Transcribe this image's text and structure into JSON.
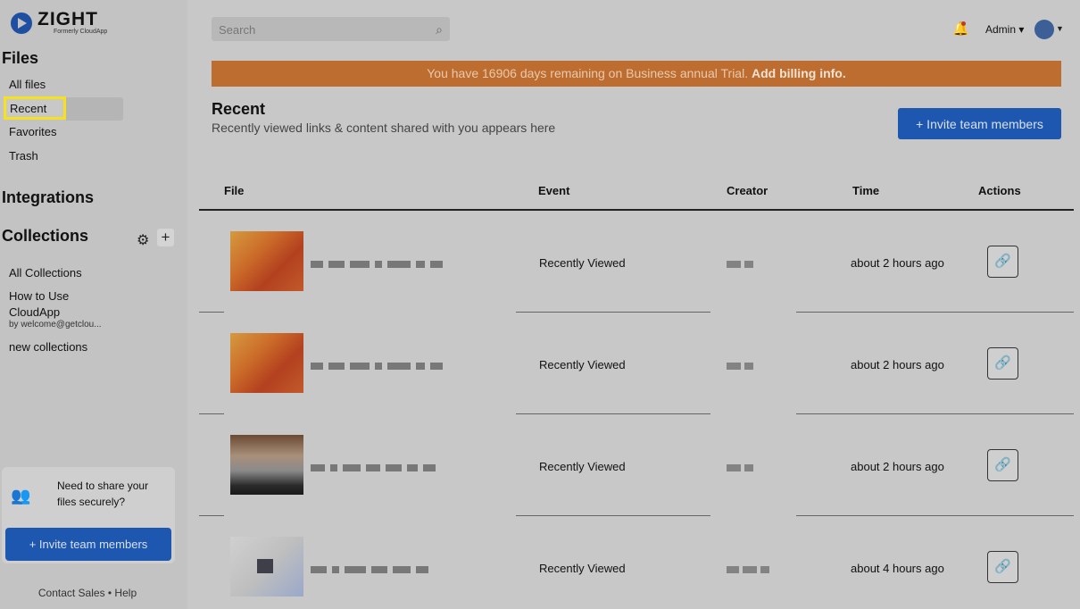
{
  "brand": {
    "name": "ZIGHT",
    "sub": "Formerly CloudApp"
  },
  "sidebar": {
    "files_title": "Files",
    "nav": [
      "All files",
      "Recent",
      "Favorites",
      "Trash"
    ],
    "integrations_title": "Integrations",
    "collections_title": "Collections",
    "collections": {
      "all": "All Collections",
      "how_to_line1": "How to Use",
      "how_to_line2": "CloudApp",
      "how_to_by": "by welcome@getclou...",
      "new": "new collections"
    },
    "promo": {
      "text": "Need to share your files securely?",
      "button": "+ Invite team members"
    },
    "footer": "Contact Sales • Help"
  },
  "topbar": {
    "search_placeholder": "Search",
    "admin_label": "Admin ▾"
  },
  "banner": {
    "text": "You have 16906 days remaining on Business annual Trial.",
    "link": "Add billing info."
  },
  "main": {
    "title": "Recent",
    "subtitle": "Recently viewed links & content shared with you appears here",
    "invite_button": "+ Invite team members",
    "columns": [
      "File",
      "Event",
      "Creator",
      "Time",
      "Actions"
    ],
    "rows": [
      {
        "event": "Recently Viewed",
        "time": "about 2 hours ago"
      },
      {
        "event": "Recently Viewed",
        "time": "about 2 hours ago"
      },
      {
        "event": "Recently Viewed",
        "time": "about 2 hours ago"
      },
      {
        "event": "Recently Viewed",
        "time": "about 4 hours ago"
      }
    ]
  },
  "colors": {
    "accent": "#1e57b0",
    "banner": "#bd6d30",
    "highlight": "#f5e21c"
  }
}
